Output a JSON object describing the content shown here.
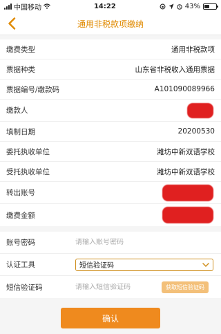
{
  "status": {
    "carrier": "中国移动",
    "time": "14:22",
    "battery": "43%",
    "battery_level": 0.43
  },
  "nav": {
    "title": "通用非税款项缴纳",
    "accent_color": "#e08a00"
  },
  "info_rows": [
    {
      "label": "缴费类型",
      "value": "通用非税款项"
    },
    {
      "label": "票据种类",
      "value": "山东省非税收入通用票据"
    },
    {
      "label": "票据编号/缴款码",
      "value": "A101090089966"
    },
    {
      "label": "缴款人",
      "value": ""
    },
    {
      "label": "填制日期",
      "value": "20200530"
    },
    {
      "label": "委托执收单位",
      "value": "潍坊中新双语学校"
    },
    {
      "label": "受托执收单位",
      "value": "潍坊中新双语学校"
    },
    {
      "label": "转出账号",
      "value": ""
    },
    {
      "label": "缴费金额",
      "value": ""
    }
  ],
  "form": {
    "password_label": "账号密码",
    "password_placeholder": "请输入账号密码",
    "auth_label": "认证工具",
    "auth_selected": "短信验证码",
    "sms_label": "短信验证码",
    "sms_placeholder": "请输入短信验证码",
    "sms_button": "获取短信验证码"
  },
  "confirm_label": "确认"
}
